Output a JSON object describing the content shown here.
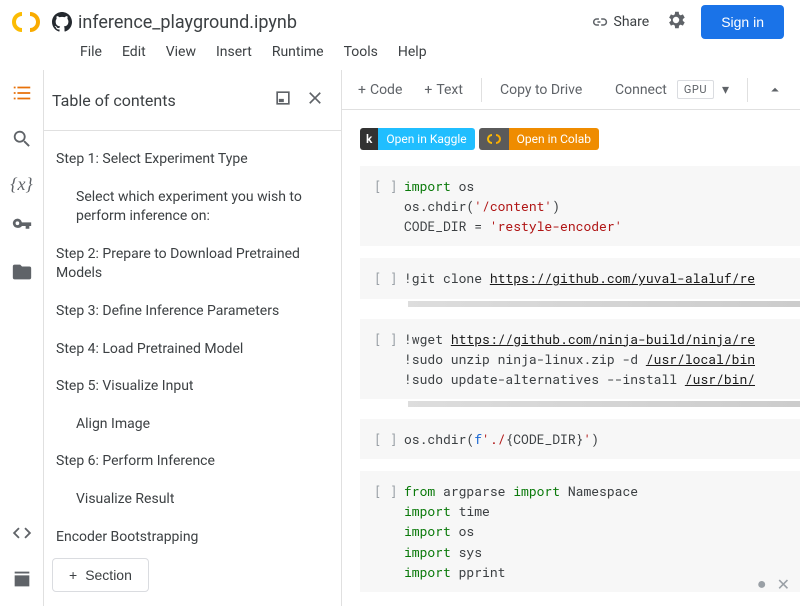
{
  "header": {
    "title": "inference_playground.ipynb",
    "share": "Share",
    "signin": "Sign in"
  },
  "menu": {
    "file": "File",
    "edit": "Edit",
    "view": "View",
    "insert": "Insert",
    "runtime": "Runtime",
    "tools": "Tools",
    "help": "Help"
  },
  "toc": {
    "title": "Table of contents",
    "items": [
      {
        "label": "Step 1: Select Experiment Type",
        "indent": 0
      },
      {
        "label": "Select which experiment you wish to perform inference on:",
        "indent": 1
      },
      {
        "label": "Step 2: Prepare to Download Pretrained Models",
        "indent": 0
      },
      {
        "label": "Step 3: Define Inference Parameters",
        "indent": 0
      },
      {
        "label": "Step 4: Load Pretrained Model",
        "indent": 0
      },
      {
        "label": "Step 5: Visualize Input",
        "indent": 0
      },
      {
        "label": "Align Image",
        "indent": 1
      },
      {
        "label": "Step 6: Perform Inference",
        "indent": 0
      },
      {
        "label": "Visualize Result",
        "indent": 1
      },
      {
        "label": "Encoder Bootstrapping",
        "indent": 0
      }
    ],
    "section_btn": "Section"
  },
  "toolbar": {
    "code": "Code",
    "text": "Text",
    "copy": "Copy to Drive",
    "connect": "Connect",
    "gpu": "GPU"
  },
  "badges": {
    "kaggle_k": "k",
    "kaggle": "Open in Kaggle",
    "colab": "Open in Colab"
  },
  "cells": {
    "c1": "import os\nos.chdir('/content')\nCODE_DIR = 'restyle-encoder'",
    "c2": "!git clone https://github.com/yuval-alaluf/re",
    "c3": "!wget https://github.com/ninja-build/ninja/re\n!sudo unzip ninja-linux.zip -d /usr/local/bin\n!sudo update-alternatives --install /usr/bin/",
    "c4": "os.chdir(f'./{CODE_DIR}')",
    "c5": "from argparse import Namespace\nimport time\nimport os\nimport sys\nimport pprint"
  },
  "prompt": "[ ]"
}
